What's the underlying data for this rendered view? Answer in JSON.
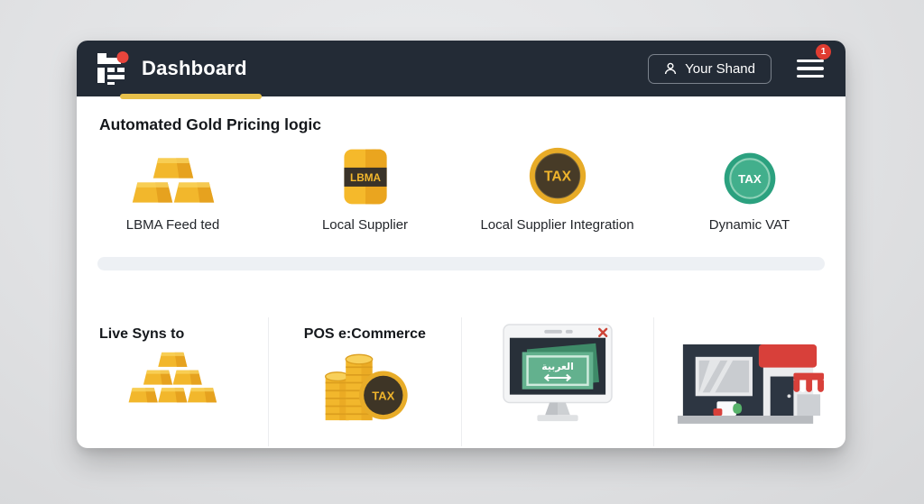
{
  "header": {
    "title": "Dashboard",
    "user_button_label": "Your Shand",
    "menu_badge": "1"
  },
  "pricing": {
    "heading": "Automated Gold Pricing logic",
    "items": [
      {
        "label": "LBMA Feed ted",
        "icon": "gold-bars-icon"
      },
      {
        "label": "Local Supplier",
        "icon": "lbma-gold-bar-icon",
        "badge": "LBMA"
      },
      {
        "label": "Local Supplier Integration",
        "icon": "gold-tax-coin-icon",
        "badge": "TAX"
      },
      {
        "label": "Dynamic VAT",
        "icon": "teal-tax-coin-icon",
        "badge": "TAX"
      }
    ]
  },
  "sync": {
    "cells": [
      {
        "heading": "Live Syns to",
        "icon": "gold-bars-pyramid-icon"
      },
      {
        "heading": "POS e:Commerce",
        "icon": "coins-tax-icon",
        "coin_badge": "TAX"
      },
      {
        "icon": "monitor-currency-icon",
        "screen_text": "العربية"
      },
      {
        "icon": "storefront-icon"
      }
    ]
  },
  "colors": {
    "header_bg": "#232B36",
    "accent_gold": "#F2B72C",
    "tab_underline": "#E7C04A",
    "badge_red": "#E03C31",
    "teal_coin": "#2BA17F",
    "roof_red": "#D8403A",
    "progress_track": "#EDF0F4"
  }
}
